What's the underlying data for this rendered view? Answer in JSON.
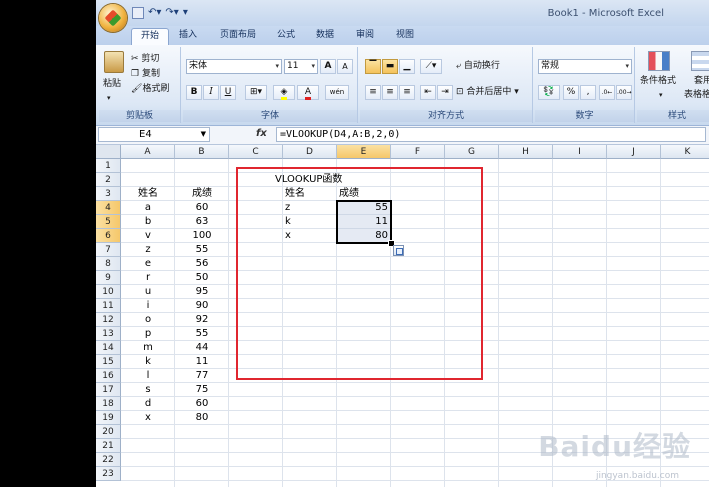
{
  "window": {
    "title": "Book1 - Microsoft Excel"
  },
  "tabs": [
    "开始",
    "插入",
    "页面布局",
    "公式",
    "数据",
    "审阅",
    "视图"
  ],
  "ribbon": {
    "clipboard": {
      "paste": "粘贴",
      "cut": "剪切",
      "copy": "复制",
      "format_painter": "格式刷",
      "label": "剪贴板"
    },
    "font": {
      "name": "宋体",
      "size": "11",
      "bold": "B",
      "italic": "I",
      "underline": "U",
      "label": "字体",
      "grow": "A",
      "shrink": "A",
      "font_color": "A",
      "phonetic": "wén"
    },
    "alignment": {
      "wrap_text": "自动换行",
      "merge_center": "合并后居中",
      "label": "对齐方式"
    },
    "number": {
      "format": "常规",
      "percent": "%",
      "comma": ",",
      "label": "数字"
    },
    "styles": {
      "conditional": "条件格式",
      "table": "套用",
      "table_sub": "表格格",
      "label": "样式"
    }
  },
  "formula_bar": {
    "name_box": "E4",
    "fx": "fx",
    "formula": "=VLOOKUP(D4,A:B,2,0)"
  },
  "columns": [
    "A",
    "B",
    "C",
    "D",
    "E",
    "F",
    "G",
    "H",
    "I",
    "J",
    "K"
  ],
  "rows": [
    "1",
    "2",
    "3",
    "4",
    "5",
    "6",
    "7",
    "8",
    "9",
    "10",
    "11",
    "12",
    "13",
    "14",
    "15",
    "16",
    "17",
    "18",
    "19",
    "20",
    "21",
    "22",
    "23"
  ],
  "sheet": {
    "header_name": "姓名",
    "header_score": "成绩",
    "names": [
      "a",
      "b",
      "v",
      "z",
      "e",
      "r",
      "u",
      "i",
      "o",
      "p",
      "m",
      "k",
      "l",
      "s",
      "d",
      "x"
    ],
    "scores": [
      "60",
      "63",
      "100",
      "55",
      "56",
      "50",
      "95",
      "90",
      "92",
      "55",
      "44",
      "11",
      "77",
      "75",
      "60",
      "80"
    ],
    "title": "VLOOKUP函数",
    "lookup_header_name": "姓名",
    "lookup_header_score": "成绩",
    "lookup_names": [
      "z",
      "k",
      "x"
    ],
    "lookup_results": [
      "55",
      "11",
      "80"
    ]
  },
  "watermark": {
    "text": "Baidu经验",
    "sub": "jingyan.baidu.com"
  },
  "colors": {
    "highlight": "#e0262f",
    "selection_header": "#f5c76a"
  }
}
